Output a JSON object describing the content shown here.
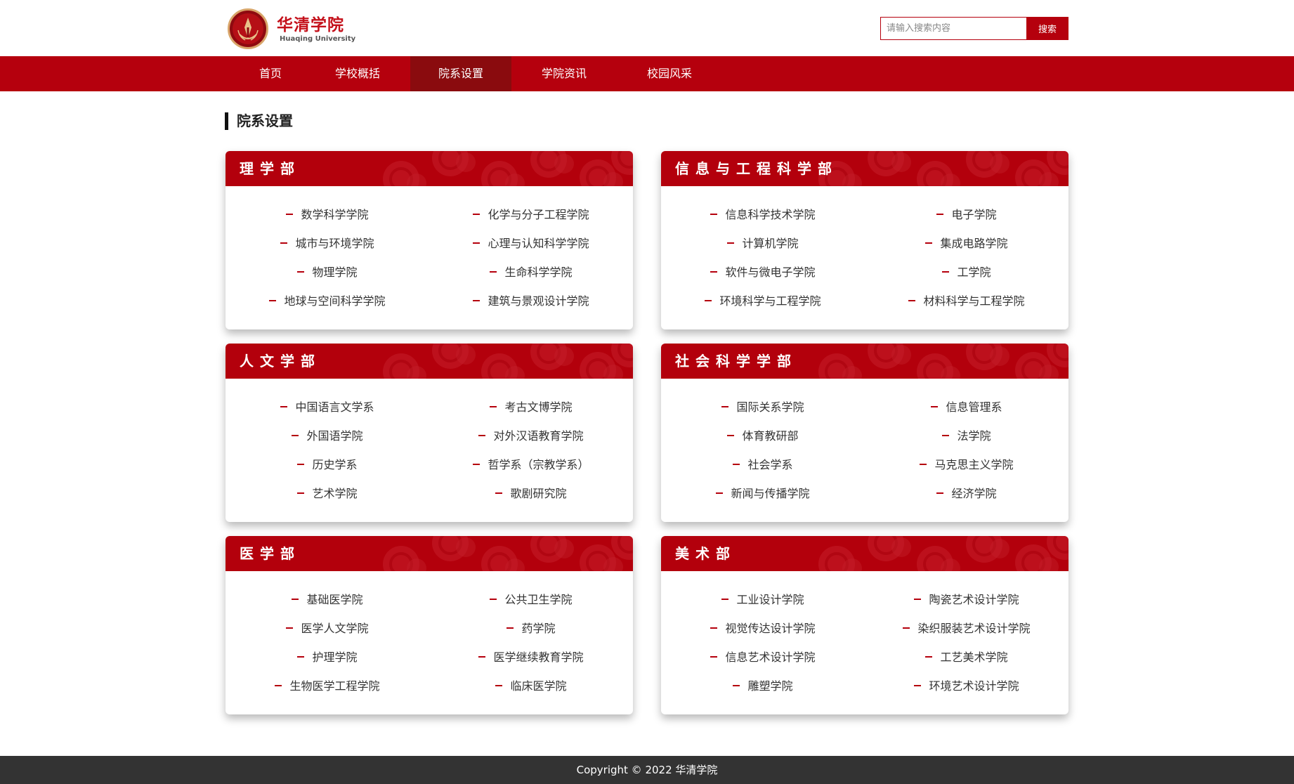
{
  "brand": {
    "name_cn": "华清学院",
    "name_en": "Huaqing University"
  },
  "search": {
    "placeholder": "请输入搜索内容",
    "button_label": "搜索"
  },
  "nav": {
    "items": [
      {
        "label": "首页",
        "active": false
      },
      {
        "label": "学校概括",
        "active": false
      },
      {
        "label": "院系设置",
        "active": true
      },
      {
        "label": "学院资讯",
        "active": false
      },
      {
        "label": "校园风采",
        "active": false
      }
    ]
  },
  "page": {
    "title": "院系设置"
  },
  "departments": [
    {
      "title": "理学部",
      "items": [
        "数学科学学院",
        "化学与分子工程学院",
        "城市与环境学院",
        "心理与认知科学学院",
        "物理学院",
        "生命科学学院",
        "地球与空间科学学院",
        "建筑与景观设计学院"
      ]
    },
    {
      "title": "信息与工程科学部",
      "items": [
        "信息科学技术学院",
        "电子学院",
        "计算机学院",
        "集成电路学院",
        "软件与微电子学院",
        "工学院",
        "环境科学与工程学院",
        "材料科学与工程学院"
      ]
    },
    {
      "title": "人文学部",
      "items": [
        "中国语言文学系",
        "考古文博学院",
        "外国语学院",
        "对外汉语教育学院",
        "历史学系",
        "哲学系（宗教学系）",
        "艺术学院",
        "歌剧研究院"
      ]
    },
    {
      "title": "社会科学学部",
      "items": [
        "国际关系学院",
        "信息管理系",
        "体育教研部",
        "法学院",
        "社会学系",
        "马克思主义学院",
        "新闻与传播学院",
        "经济学院"
      ]
    },
    {
      "title": "医学部",
      "items": [
        "基础医学院",
        "公共卫生学院",
        "医学人文学院",
        "药学院",
        "护理学院",
        "医学继续教育学院",
        "生物医学工程学院",
        "临床医学院"
      ]
    },
    {
      "title": "美术部",
      "items": [
        "工业设计学院",
        "陶瓷艺术设计学院",
        "视觉传达设计学院",
        "染织服装艺术设计学院",
        "信息艺术设计学院",
        "工艺美术学院",
        "雕塑学院",
        "环境艺术设计学院"
      ]
    }
  ],
  "footer": {
    "copyright": "Copyright © 2022 华清学院"
  },
  "colors": {
    "brand_red": "#b5000d",
    "nav_active": "#8a0b0e",
    "footer_bg": "#333333"
  }
}
